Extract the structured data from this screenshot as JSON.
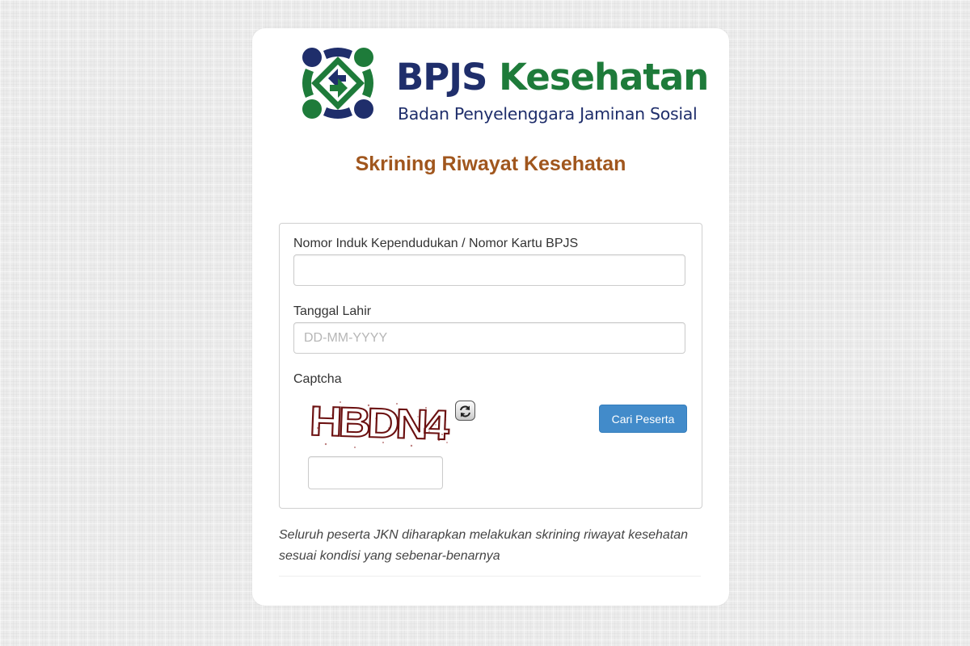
{
  "brand": {
    "name_part1": "BPJS",
    "name_part2": "Kesehatan",
    "subtitle": "Badan Penyelenggara Jaminan Sosial",
    "colors": {
      "navy": "#1f2e6b",
      "green": "#1e7b3a"
    }
  },
  "page": {
    "title": "Skrining Riwayat Kesehatan",
    "title_color": "#a0561d"
  },
  "form": {
    "nik_label": "Nomor Induk Kependudukan / Nomor Kartu BPJS",
    "nik_value": "",
    "dob_label": "Tanggal Lahir",
    "dob_placeholder": "DD-MM-YYYY",
    "dob_value": "",
    "captcha_label": "Captcha",
    "captcha_text": "HBDN4",
    "captcha_value": "",
    "refresh_icon": "refresh-icon",
    "submit_label": "Cari Peserta",
    "submit_color": "#428bca"
  },
  "note": "Seluruh peserta JKN diharapkan melakukan skrining riwayat kesehatan sesuai kondisi yang sebenar-benarnya"
}
